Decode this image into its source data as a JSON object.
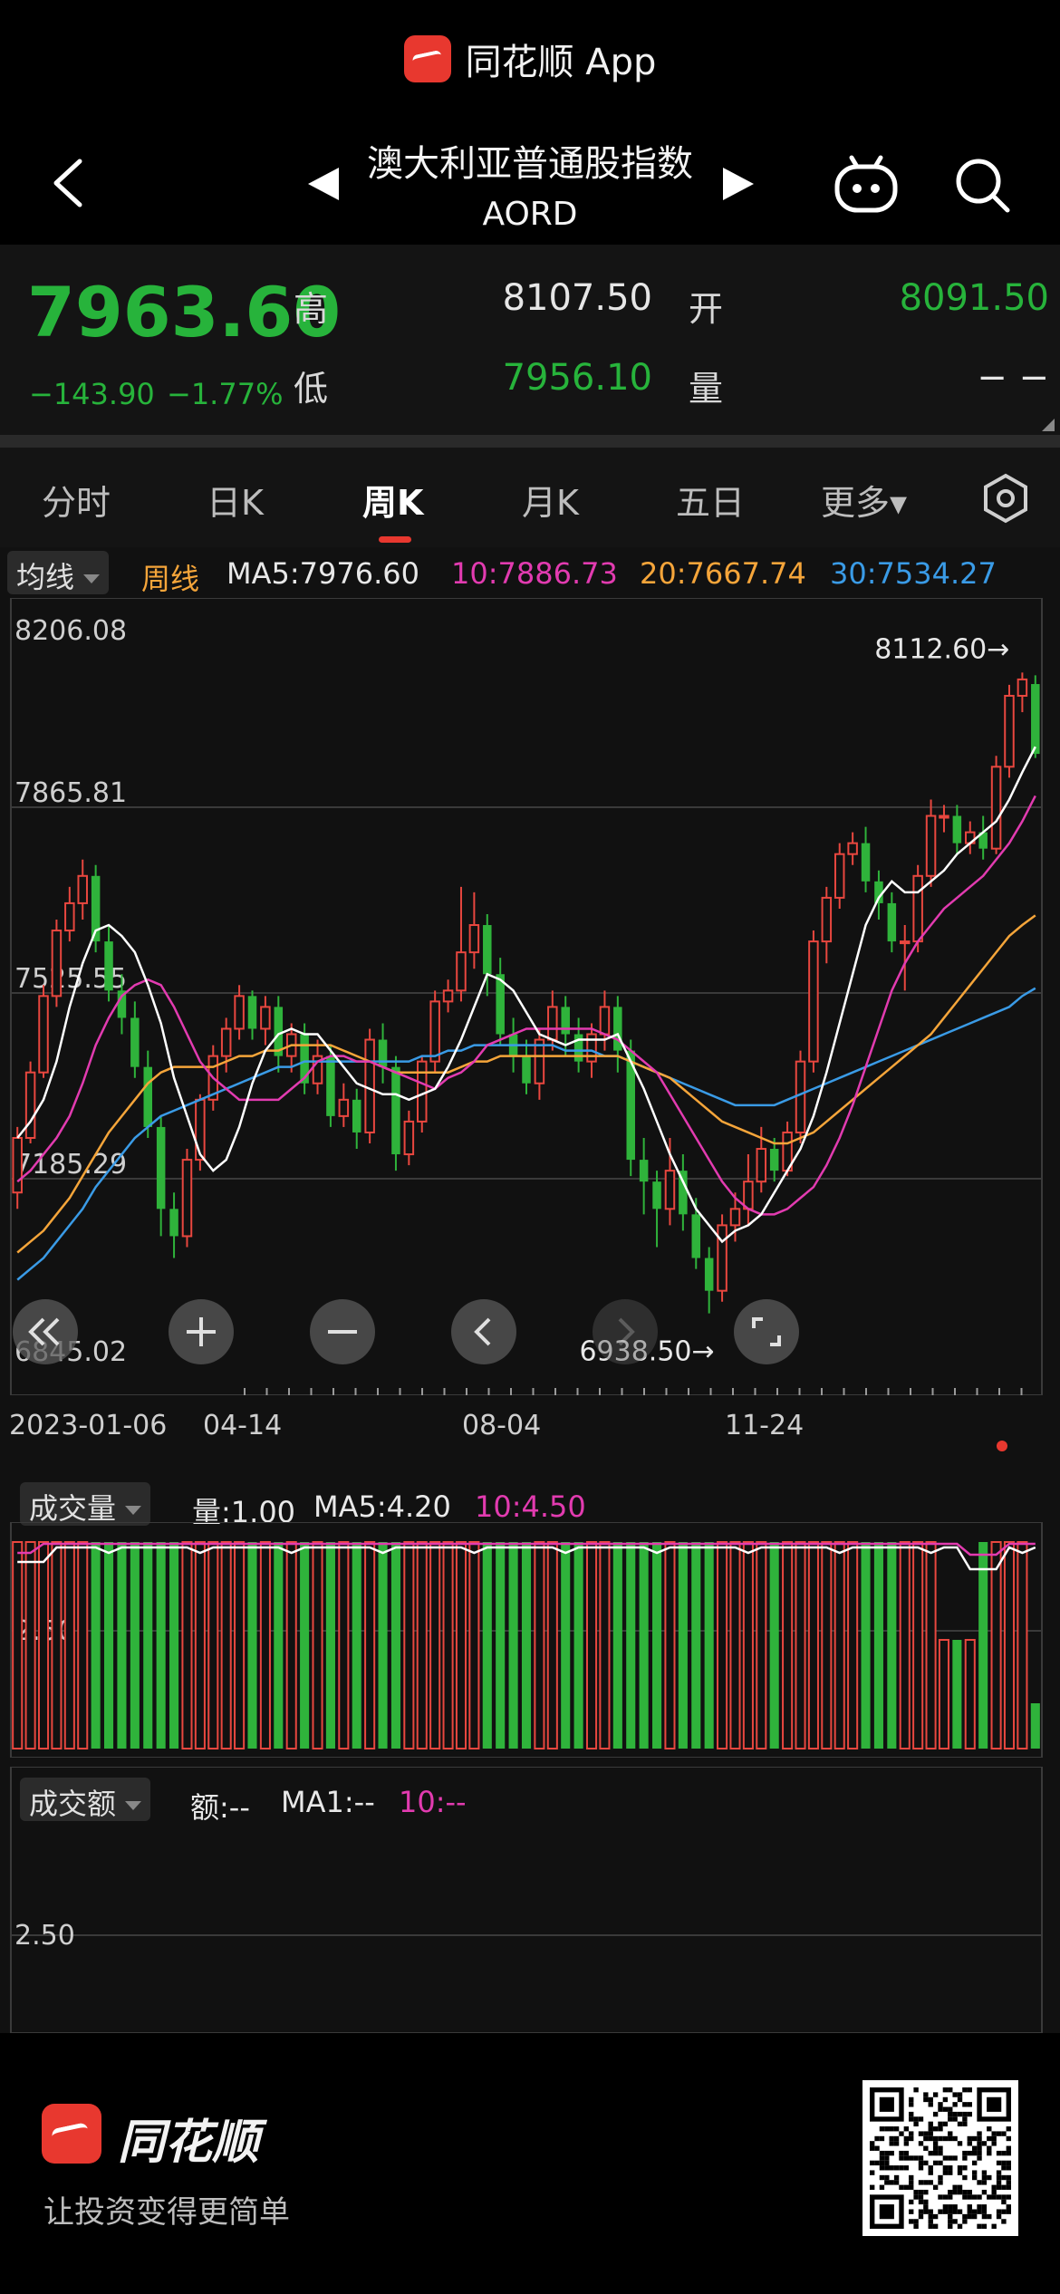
{
  "app_banner": {
    "name": "同花顺 App"
  },
  "nav": {
    "title": "澳大利亚普通股指数",
    "code": "AORD"
  },
  "quote": {
    "price": "7963.60",
    "change": "−143.90",
    "change_pct": "−1.77%",
    "high_label": "高",
    "high": "8107.50",
    "open_label": "开",
    "open": "8091.50",
    "low_label": "低",
    "low": "7956.10",
    "volume_label": "量",
    "volume": "− −"
  },
  "tabs": [
    {
      "label": "分时"
    },
    {
      "label": "日K"
    },
    {
      "label": "周K"
    },
    {
      "label": "月K"
    },
    {
      "label": "五日"
    },
    {
      "label": "更多▾"
    }
  ],
  "ma_bar": {
    "selector": "均线",
    "period": "周线",
    "ma5": "MA5:7976.60",
    "ma10": "10:7886.73",
    "ma20": "20:7667.74",
    "ma30": "30:7534.27"
  },
  "kline_axis": {
    "y_labels": [
      "8206.08",
      "7865.81",
      "7525.55",
      "7185.29",
      "6845.02"
    ],
    "max_marker": "8112.60→",
    "min_marker": "6938.50→",
    "x_labels": [
      "2023-01-06",
      "04-14",
      "08-04",
      "11-24"
    ]
  },
  "volume_panel": {
    "selector": "成交量",
    "vol": "量:1.00",
    "ma5": "MA5:4.20",
    "ma10": "10:4.50",
    "y_label": "2.50"
  },
  "amount_panel": {
    "selector": "成交额",
    "amt": "额:--",
    "ma1": "MA1:--",
    "ma10": "10:--",
    "y_label": "2.50"
  },
  "footer": {
    "brand": "同花顺",
    "slogan": "让投资变得更简单"
  },
  "colors": {
    "up": "#e8473f",
    "down": "#2fb33b",
    "ma5": "#ffffff",
    "ma10": "#e23bb0",
    "ma20": "#f5a53a",
    "ma30": "#3a9be6"
  },
  "chart_data": {
    "type": "candlestick",
    "period": "weekly",
    "ylim": [
      6845.02,
      8206.08
    ],
    "candles": [
      [
        7160,
        7260,
        7130,
        7280
      ],
      [
        7260,
        7380,
        7250,
        7400
      ],
      [
        7380,
        7520,
        7370,
        7540
      ],
      [
        7520,
        7640,
        7500,
        7660
      ],
      [
        7640,
        7690,
        7620,
        7720
      ],
      [
        7690,
        7740,
        7660,
        7770
      ],
      [
        7740,
        7620,
        7600,
        7760
      ],
      [
        7620,
        7530,
        7510,
        7650
      ],
      [
        7530,
        7480,
        7450,
        7560
      ],
      [
        7480,
        7390,
        7370,
        7510
      ],
      [
        7390,
        7280,
        7260,
        7420
      ],
      [
        7280,
        7130,
        7080,
        7300
      ],
      [
        7130,
        7080,
        7040,
        7160
      ],
      [
        7080,
        7220,
        7060,
        7240
      ],
      [
        7220,
        7330,
        7200,
        7340
      ],
      [
        7330,
        7410,
        7310,
        7430
      ],
      [
        7410,
        7460,
        7380,
        7480
      ],
      [
        7460,
        7520,
        7440,
        7540
      ],
      [
        7520,
        7460,
        7440,
        7530
      ],
      [
        7460,
        7500,
        7430,
        7520
      ],
      [
        7500,
        7410,
        7380,
        7520
      ],
      [
        7410,
        7450,
        7380,
        7470
      ],
      [
        7450,
        7360,
        7340,
        7470
      ],
      [
        7360,
        7410,
        7340,
        7440
      ],
      [
        7410,
        7300,
        7280,
        7430
      ],
      [
        7300,
        7330,
        7280,
        7360
      ],
      [
        7330,
        7270,
        7240,
        7350
      ],
      [
        7270,
        7440,
        7250,
        7460
      ],
      [
        7440,
        7390,
        7360,
        7470
      ],
      [
        7390,
        7230,
        7200,
        7410
      ],
      [
        7230,
        7290,
        7210,
        7310
      ],
      [
        7290,
        7400,
        7270,
        7410
      ],
      [
        7400,
        7510,
        7380,
        7530
      ],
      [
        7510,
        7530,
        7490,
        7550
      ],
      [
        7530,
        7600,
        7510,
        7720
      ],
      [
        7600,
        7650,
        7570,
        7710
      ],
      [
        7650,
        7560,
        7520,
        7670
      ],
      [
        7560,
        7450,
        7430,
        7590
      ],
      [
        7450,
        7410,
        7380,
        7480
      ],
      [
        7410,
        7360,
        7340,
        7440
      ],
      [
        7360,
        7440,
        7330,
        7460
      ],
      [
        7440,
        7500,
        7420,
        7530
      ],
      [
        7500,
        7450,
        7410,
        7520
      ],
      [
        7450,
        7400,
        7380,
        7480
      ],
      [
        7400,
        7450,
        7370,
        7470
      ],
      [
        7450,
        7500,
        7420,
        7530
      ],
      [
        7500,
        7420,
        7380,
        7520
      ],
      [
        7420,
        7220,
        7190,
        7440
      ],
      [
        7220,
        7180,
        7120,
        7260
      ],
      [
        7180,
        7130,
        7060,
        7200
      ],
      [
        7130,
        7200,
        7100,
        7260
      ],
      [
        7200,
        7120,
        7090,
        7230
      ],
      [
        7120,
        7040,
        7020,
        7150
      ],
      [
        7040,
        6980,
        6938.5,
        7060
      ],
      [
        6980,
        7100,
        6960,
        7120
      ],
      [
        7100,
        7130,
        7070,
        7160
      ],
      [
        7130,
        7180,
        7100,
        7230
      ],
      [
        7180,
        7240,
        7160,
        7280
      ],
      [
        7240,
        7200,
        7180,
        7260
      ],
      [
        7200,
        7270,
        7190,
        7290
      ],
      [
        7270,
        7400,
        7250,
        7420
      ],
      [
        7400,
        7620,
        7380,
        7640
      ],
      [
        7620,
        7700,
        7580,
        7720
      ],
      [
        7700,
        7780,
        7680,
        7800
      ],
      [
        7780,
        7800,
        7760,
        7820
      ],
      [
        7800,
        7730,
        7710,
        7830
      ],
      [
        7730,
        7690,
        7660,
        7750
      ],
      [
        7690,
        7620,
        7600,
        7710
      ],
      [
        7620,
        7620,
        7530,
        7650
      ],
      [
        7620,
        7740,
        7600,
        7760
      ],
      [
        7740,
        7850,
        7720,
        7880
      ],
      [
        7850,
        7850,
        7820,
        7870
      ],
      [
        7850,
        7800,
        7780,
        7870
      ],
      [
        7800,
        7820,
        7780,
        7840
      ],
      [
        7820,
        7790,
        7770,
        7850
      ],
      [
        7790,
        7940,
        7780,
        7960
      ],
      [
        7940,
        8070,
        7920,
        8090
      ],
      [
        8070,
        8100,
        8040,
        8112.6
      ],
      [
        8091.5,
        7963.6,
        7956.1,
        8107.5
      ]
    ],
    "ma5": [
      7260,
      7290,
      7330,
      7400,
      7500,
      7580,
      7640,
      7650,
      7630,
      7600,
      7540,
      7470,
      7370,
      7300,
      7230,
      7200,
      7220,
      7280,
      7360,
      7420,
      7450,
      7460,
      7450,
      7450,
      7420,
      7390,
      7360,
      7350,
      7340,
      7340,
      7330,
      7340,
      7350,
      7390,
      7440,
      7500,
      7560,
      7550,
      7530,
      7490,
      7450,
      7440,
      7430,
      7440,
      7440,
      7440,
      7450,
      7400,
      7350,
      7290,
      7230,
      7180,
      7130,
      7100,
      7070,
      7090,
      7100,
      7120,
      7160,
      7200,
      7240,
      7300,
      7380,
      7470,
      7560,
      7650,
      7700,
      7730,
      7710,
      7710,
      7730,
      7750,
      7780,
      7800,
      7820,
      7840,
      7880,
      7930,
      7976.6
    ],
    "ma10": [
      7180,
      7200,
      7230,
      7260,
      7300,
      7360,
      7430,
      7480,
      7520,
      7540,
      7550,
      7540,
      7500,
      7450,
      7400,
      7370,
      7350,
      7330,
      7330,
      7330,
      7330,
      7350,
      7370,
      7400,
      7410,
      7410,
      7400,
      7400,
      7390,
      7380,
      7370,
      7360,
      7350,
      7370,
      7380,
      7400,
      7430,
      7440,
      7450,
      7460,
      7460,
      7460,
      7460,
      7460,
      7460,
      7450,
      7440,
      7420,
      7400,
      7380,
      7340,
      7300,
      7260,
      7220,
      7180,
      7150,
      7130,
      7120,
      7120,
      7130,
      7150,
      7170,
      7210,
      7260,
      7320,
      7390,
      7460,
      7530,
      7580,
      7620,
      7650,
      7680,
      7700,
      7720,
      7740,
      7770,
      7800,
      7840,
      7886.73
    ],
    "ma20": [
      7050,
      7070,
      7090,
      7120,
      7150,
      7190,
      7230,
      7270,
      7300,
      7330,
      7360,
      7380,
      7390,
      7390,
      7390,
      7390,
      7400,
      7410,
      7410,
      7420,
      7420,
      7430,
      7430,
      7430,
      7430,
      7420,
      7410,
      7400,
      7390,
      7380,
      7380,
      7380,
      7380,
      7380,
      7390,
      7400,
      7400,
      7410,
      7410,
      7410,
      7410,
      7410,
      7410,
      7410,
      7410,
      7410,
      7410,
      7400,
      7390,
      7380,
      7370,
      7350,
      7330,
      7310,
      7290,
      7280,
      7270,
      7260,
      7250,
      7250,
      7260,
      7270,
      7290,
      7310,
      7330,
      7350,
      7370,
      7390,
      7410,
      7430,
      7450,
      7480,
      7510,
      7540,
      7570,
      7600,
      7630,
      7650,
      7667.74
    ],
    "ma30": [
      7000,
      7020,
      7040,
      7070,
      7100,
      7130,
      7170,
      7200,
      7230,
      7260,
      7280,
      7300,
      7310,
      7320,
      7330,
      7340,
      7350,
      7360,
      7370,
      7380,
      7390,
      7390,
      7400,
      7400,
      7400,
      7400,
      7400,
      7400,
      7400,
      7400,
      7400,
      7410,
      7410,
      7420,
      7420,
      7430,
      7430,
      7430,
      7430,
      7430,
      7430,
      7430,
      7420,
      7420,
      7420,
      7410,
      7410,
      7400,
      7390,
      7380,
      7370,
      7360,
      7350,
      7340,
      7330,
      7320,
      7320,
      7320,
      7320,
      7330,
      7340,
      7350,
      7360,
      7370,
      7380,
      7390,
      7400,
      7410,
      7420,
      7430,
      7440,
      7450,
      7460,
      7470,
      7480,
      7490,
      7500,
      7520,
      7534.27
    ]
  }
}
